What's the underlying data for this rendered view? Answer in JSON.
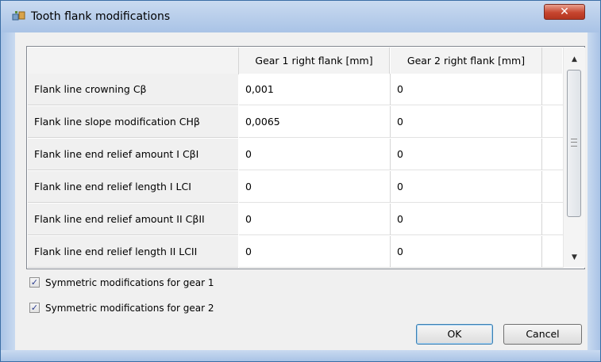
{
  "window": {
    "title": "Tooth flank modifications",
    "close_glyph": "✕",
    "title_icon": "gear-pair-icon"
  },
  "table": {
    "columns": [
      "Gear 1 right flank [mm]",
      "Gear 2 right flank [mm]",
      ""
    ],
    "rows": [
      {
        "label": "Flank line crowning Cβ",
        "values": [
          "0,001",
          "0"
        ]
      },
      {
        "label": "Flank line slope modification CHβ",
        "values": [
          "0,0065",
          "0"
        ]
      },
      {
        "label": "Flank line end relief amount I CβI",
        "values": [
          "0",
          "0"
        ]
      },
      {
        "label": "Flank line end relief length I LCI",
        "values": [
          "0",
          "0"
        ]
      },
      {
        "label": "Flank line end relief amount II CβII",
        "values": [
          "0",
          "0"
        ]
      },
      {
        "label": "Flank line end relief length II LCII",
        "values": [
          "0",
          "0"
        ]
      }
    ],
    "scroll_up_glyph": "▲",
    "scroll_down_glyph": "▼"
  },
  "options": {
    "sym_gear1_label": "Symmetric modifications for gear 1",
    "sym_gear1_checked": true,
    "sym_gear2_label": "Symmetric modifications for gear 2",
    "sym_gear2_checked": true,
    "check_glyph": "✓"
  },
  "buttons": {
    "ok": "OK",
    "cancel": "Cancel"
  },
  "colors": {
    "titlebar": "#a9c3e6",
    "close": "#c6452f",
    "grid_header": "#f3f3f3",
    "window_bg": "#f0f0f0"
  }
}
